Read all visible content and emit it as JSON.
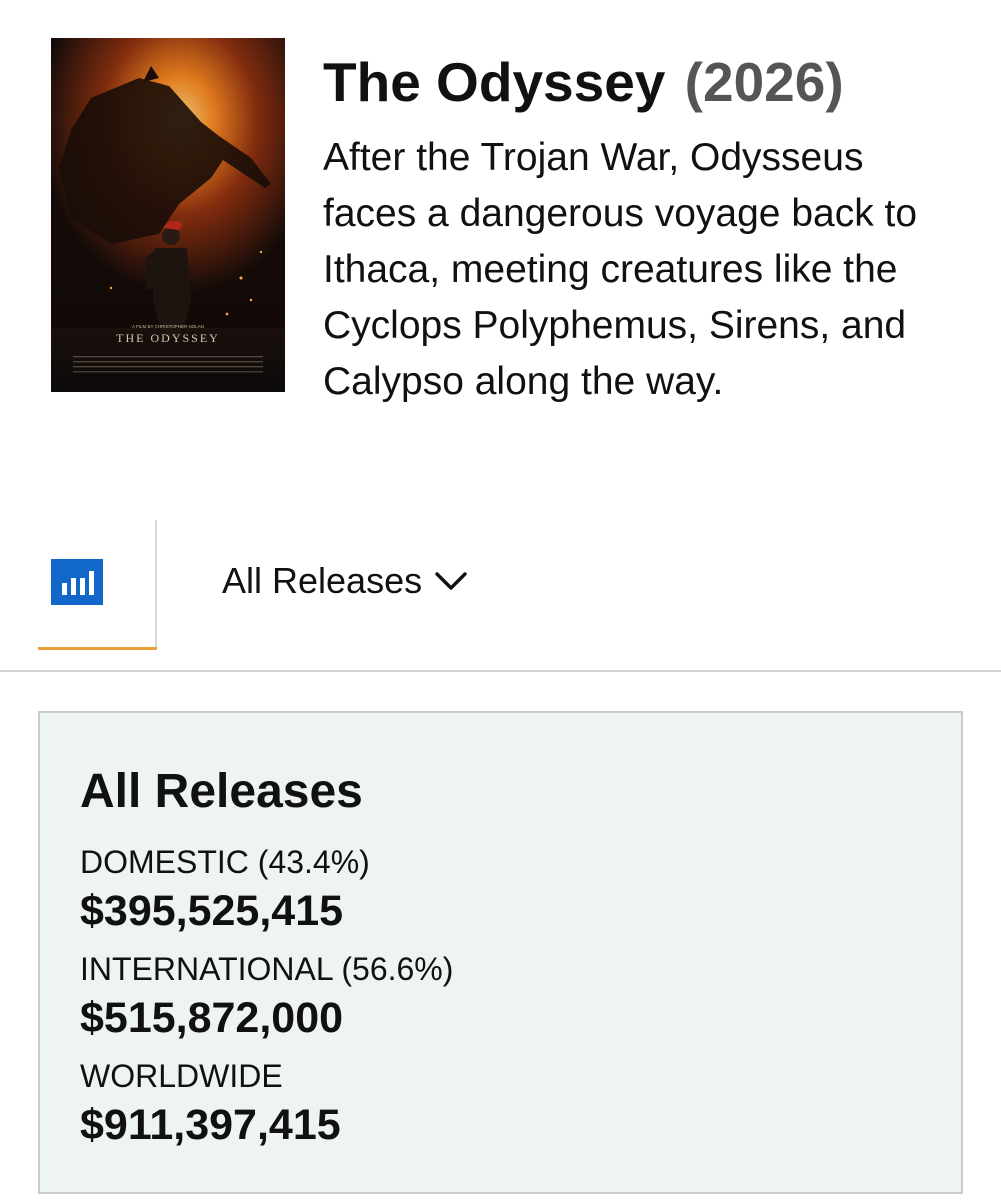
{
  "movie": {
    "title": "The Odyssey",
    "year": "(2026)",
    "synopsis": "After the Trojan War, Odysseus faces a dangerous voyage back to Ithaca, meeting creatures like the Cyclops Polyphemus, Sirens, and Calypso along the way.",
    "poster": {
      "icon": "movie-poster-image",
      "top_text": "A FILM BY CHRISTOPHER NOLAN",
      "title_text": "THE ODYSSEY"
    }
  },
  "tabs": {
    "chart_tab_icon": "bar-chart-icon",
    "releases_dropdown_label": "All Releases",
    "dropdown_icon": "chevron-down-icon",
    "active_underline_color": "#e9a23b",
    "icon_color": "#1168c8"
  },
  "summary": {
    "heading": "All Releases",
    "rows": [
      {
        "label": "DOMESTIC (43.4%)",
        "value": "$395,525,415"
      },
      {
        "label": "INTERNATIONAL (56.6%)",
        "value": "$515,872,000"
      },
      {
        "label": "WORLDWIDE",
        "value": "$911,397,415"
      }
    ],
    "background": "#eef4f4"
  }
}
